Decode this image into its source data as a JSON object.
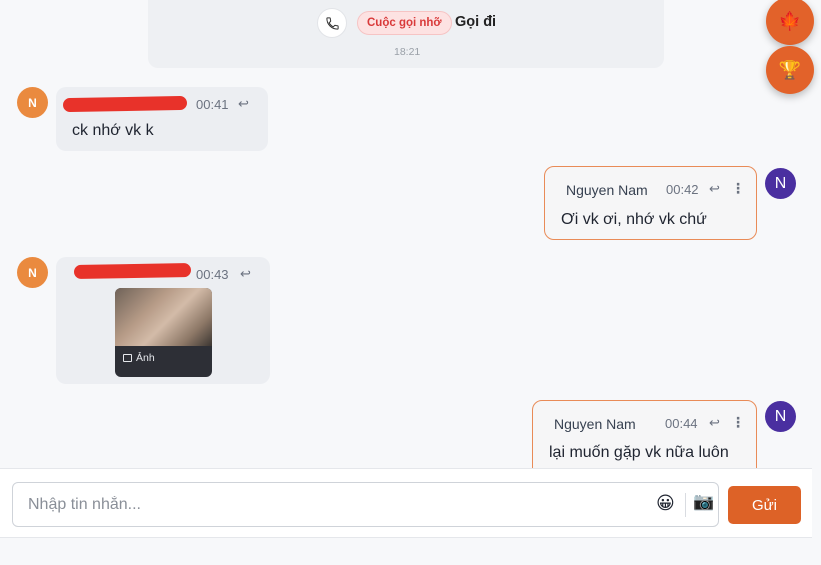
{
  "call_log": {
    "badge": "Cuộc gọi nhỡ",
    "label": "Gọi đi",
    "time": "18:21"
  },
  "messages": [
    {
      "direction": "incoming",
      "avatar": "N",
      "time": "00:41",
      "text": "ck nhớ vk k"
    },
    {
      "direction": "outgoing",
      "avatar": "N",
      "sender": "Nguyen Nam",
      "time": "00:42",
      "text": "Ơi vk ơi, nhớ vk chứ"
    },
    {
      "direction": "incoming",
      "avatar": "N",
      "time": "00:43",
      "attachment_label": "Ảnh"
    },
    {
      "direction": "outgoing",
      "avatar": "N",
      "sender": "Nguyen Nam",
      "time": "00:44",
      "text": "lại muốn gặp vk nữa luôn"
    }
  ],
  "composer": {
    "placeholder": "Nhập tin nhắn...",
    "emoji_icon": "😀",
    "camera_icon": "📷",
    "send_label": "Gửi"
  },
  "fabs": [
    {
      "icon": "maple-leaf-icon",
      "glyph": "🍁"
    },
    {
      "icon": "trophy-icon",
      "glyph": "🏆"
    }
  ],
  "colors": {
    "accent": "#dd6227",
    "incoming_avatar": "#ea8a3f",
    "outgoing_avatar": "#4a2fa0",
    "outgoing_border": "#e98b57",
    "missed_call": "#d93a3a",
    "redaction": "#e8322a"
  }
}
